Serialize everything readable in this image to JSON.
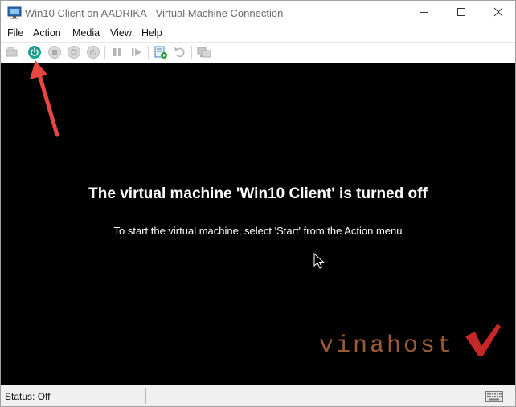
{
  "window": {
    "title": "Win10 Client on AADRIKA - Virtual Machine Connection",
    "app_icon": "vm-connection-icon",
    "controls": [
      "minimize-icon",
      "maximize-icon",
      "close-icon"
    ]
  },
  "menu": {
    "items": [
      {
        "label": "File"
      },
      {
        "label": "Action"
      },
      {
        "label": "Media"
      },
      {
        "label": "View"
      },
      {
        "label": "Help"
      }
    ]
  },
  "toolbar": {
    "buttons": [
      {
        "icon": "ctrl-alt-del-icon",
        "enabled": false
      },
      {
        "icon": "start-icon",
        "enabled": true,
        "color": "#1a9e8f"
      },
      {
        "icon": "turn-off-icon",
        "enabled": false
      },
      {
        "icon": "shut-down-icon",
        "enabled": false
      },
      {
        "icon": "save-icon",
        "enabled": false
      },
      {
        "icon": "pause-icon",
        "enabled": false
      },
      {
        "icon": "resume-icon",
        "enabled": false
      },
      {
        "icon": "checkpoint-icon",
        "enabled": true
      },
      {
        "icon": "revert-icon",
        "enabled": false
      },
      {
        "icon": "enhanced-session-icon",
        "enabled": false
      }
    ]
  },
  "screen": {
    "background": "#000000",
    "title": "The virtual machine 'Win10 Client' is turned off",
    "subtitle": "To start the virtual machine, select 'Start' from the Action menu",
    "annotation_color": "#e8473f",
    "watermark": "vinahost",
    "watermark_color": "#9a5a35"
  },
  "status": {
    "text": "Status: Off",
    "keyboard_icon": "keyboard-icon"
  }
}
